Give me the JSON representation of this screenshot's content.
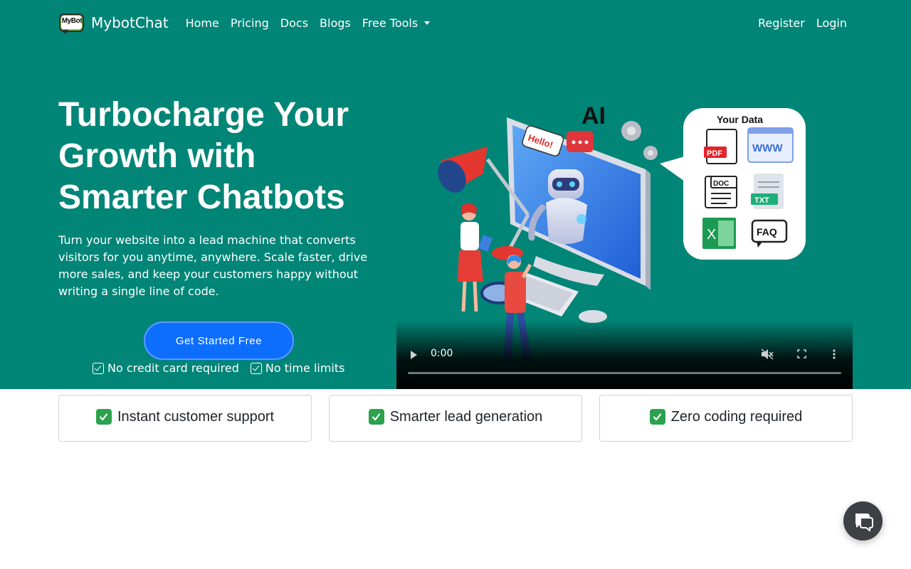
{
  "brand": {
    "name": "MybotChat",
    "logo_text": "MyBot"
  },
  "nav": {
    "links": [
      "Home",
      "Pricing",
      "Docs",
      "Blogs"
    ],
    "dropdown_label": "Free Tools",
    "right_links": [
      "Register",
      "Login"
    ]
  },
  "hero": {
    "headline_lines": [
      "Turbocharge Your",
      "Growth with",
      "Smarter Chatbots"
    ],
    "subcopy": "Turn your website into a lead machine that converts visitors for you anytime, anywhere. Scale faster, drive more sales, and keep your customers happy without writing a single line of code.",
    "cta_label": "Get Started Free",
    "checks": [
      "No credit card required",
      "No time limits"
    ]
  },
  "illustration": {
    "ai_label": "AI",
    "hello_label": "Hello!",
    "data_panel_title": "Your Data",
    "file_labels": [
      "PDF",
      "WWW",
      "DOC",
      "TXT",
      "FAQ"
    ]
  },
  "video": {
    "time": "0:00",
    "progress": 0
  },
  "features": [
    "Instant customer support",
    "Smarter lead generation",
    "Zero coding required"
  ],
  "colors": {
    "hero_bg": "#008577",
    "cta": "#0d6efd",
    "check_green": "#2ca24e",
    "chat_launcher": "#3d4044"
  },
  "icons": {
    "chat_launcher": "chat-bubble-icon",
    "dropdown": "caret-down-icon"
  }
}
